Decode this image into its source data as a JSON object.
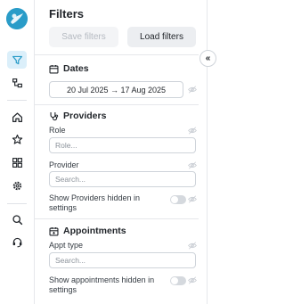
{
  "panel": {
    "title": "Filters",
    "save_label": "Save filters",
    "load_label": "Load filters"
  },
  "dates": {
    "heading": "Dates",
    "range": "20 Jul 2025 → 17 Aug 2025"
  },
  "providers": {
    "heading": "Providers",
    "role_label": "Role",
    "role_placeholder": "Role...",
    "provider_label": "Provider",
    "provider_placeholder": "Search...",
    "hidden_toggle_label": "Show Providers hidden in settings"
  },
  "appointments": {
    "heading": "Appointments",
    "type_label": "Appt type",
    "type_placeholder": "Search...",
    "hidden_toggle_label": "Show appointments hidden in settings"
  },
  "collapse_button": "«",
  "rail": {
    "items": [
      "filter-icon",
      "hierarchy-icon",
      "home-icon",
      "star-icon",
      "dashboard-icon",
      "settings-icon",
      "search-icon",
      "support-icon"
    ]
  },
  "colors": {
    "accent": "#2a9cc8",
    "active_bg": "#dbeffa"
  }
}
